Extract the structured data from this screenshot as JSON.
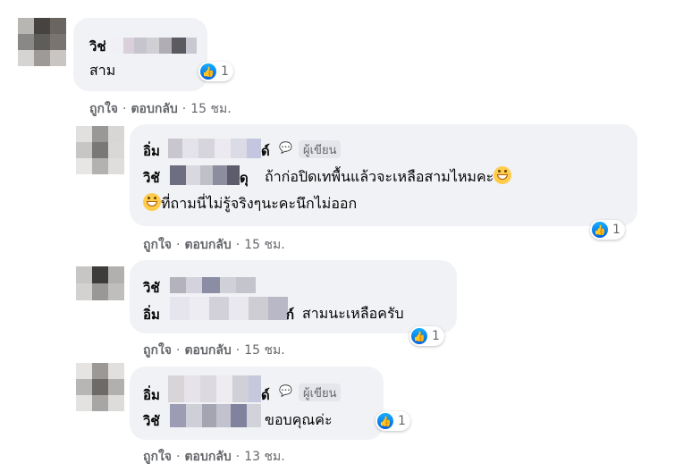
{
  "thread": {
    "like_action": "ถูกใจ",
    "reply_action": "ตอบกลับ",
    "separator": "·",
    "like_icon": "thumbs-up-icon",
    "accent": "#1877f2"
  },
  "comments": [
    {
      "name_visible": "วิช่",
      "text": "สาม",
      "reactions": "1",
      "time": "15 ชม."
    },
    {
      "name_visible": "อิ่ม",
      "name_suffix": "ด์",
      "badge": "ผู้เขียน",
      "mention": "วิชั",
      "mention_suffix": "ดุ",
      "text_line1": "ถ้าก่อปิดเทพื้นแล้วจะเหลือสามไหมคะ",
      "text_line2": "ที่ถามนี่ไม่รู้จริงๆนะคะนึกไม่ออก",
      "reactions": "1",
      "time": "15 ชม."
    },
    {
      "name_visible": "วิชั",
      "mention": "อิ่ม",
      "mention_suffix": "ก์",
      "text": "สามนะเหลือครับ",
      "reactions": "1",
      "time": "15 ชม."
    },
    {
      "name_visible": "อิ่ม",
      "name_suffix": "ด์",
      "badge": "ผู้เขียน",
      "mention": "วิชั",
      "text": "ขอบคุณค่ะ",
      "reactions": "1",
      "time": "13 ชม."
    }
  ]
}
